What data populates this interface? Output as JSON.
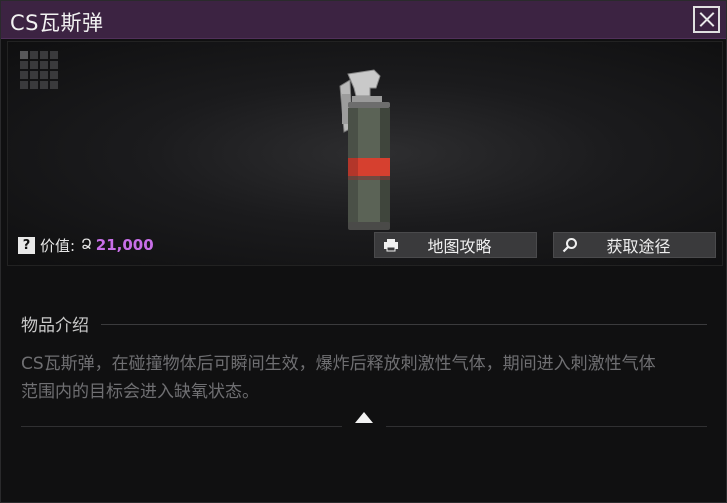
{
  "dialog": {
    "title": "CS瓦斯弹"
  },
  "item": {
    "value_label": "价值:",
    "value_amount": "21,000",
    "value_color": "#c86fe8",
    "size_grid": {
      "cols": 4,
      "rows": 4
    }
  },
  "actions": {
    "map_guide_label": "地图攻略",
    "map_guide_icon": "printer-icon",
    "source_label": "获取途径",
    "source_icon": "search-icon"
  },
  "description": {
    "header": "物品介绍",
    "text": "CS瓦斯弹，在碰撞物体后可瞬间生效，爆炸后释放刺激性气体，期间进入刺激性气体范围内的目标会进入缺氧状态。"
  },
  "colors": {
    "titlebar": "#3c2342",
    "accent_value": "#c86fe8"
  }
}
